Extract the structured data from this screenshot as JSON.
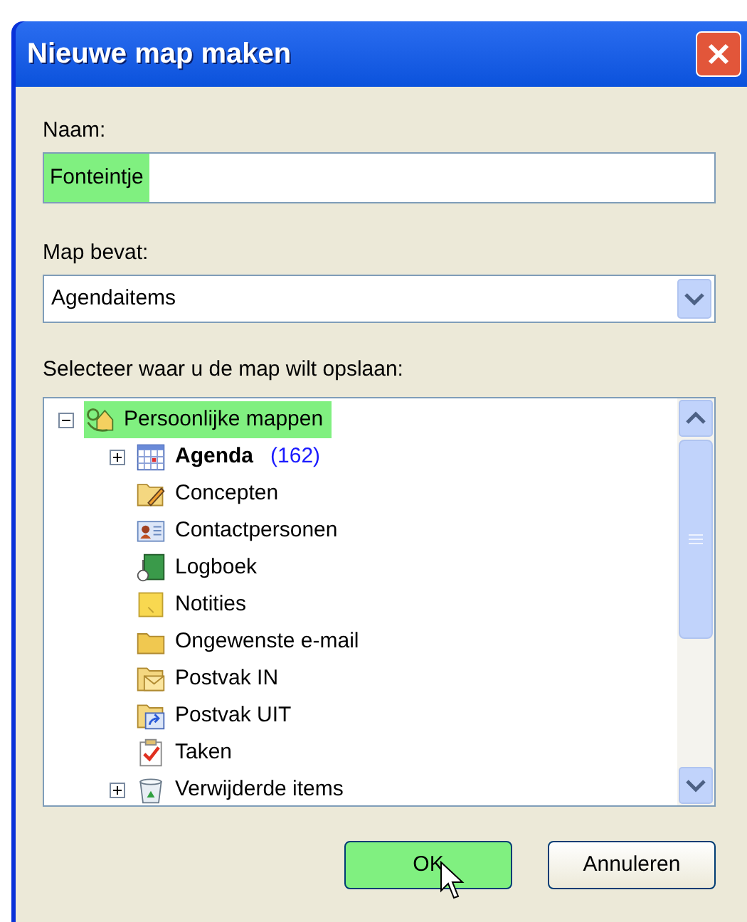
{
  "window": {
    "title": "Nieuwe map maken"
  },
  "name_field": {
    "label": "Naam:",
    "value": "Fonteintje",
    "highlighted": true
  },
  "contents_field": {
    "label": "Map bevat:",
    "value": "Agendaitems"
  },
  "tree": {
    "label": "Selecteer waar u de map wilt opslaan:",
    "items": [
      {
        "label": "Persoonlijke mappen",
        "kind": "personal",
        "expanded": true,
        "highlighted": true,
        "bold": false,
        "children": [
          {
            "label": "Agenda",
            "count": "(162)",
            "kind": "calendar",
            "expanded": false,
            "highlighted": false,
            "bold": true
          },
          {
            "label": "Concepten",
            "kind": "drafts",
            "highlighted": false,
            "bold": false
          },
          {
            "label": "Contactpersonen",
            "kind": "contacts",
            "highlighted": false,
            "bold": false
          },
          {
            "label": "Logboek",
            "kind": "journal",
            "highlighted": false,
            "bold": false
          },
          {
            "label": "Notities",
            "kind": "notes",
            "highlighted": false,
            "bold": false
          },
          {
            "label": "Ongewenste e-mail",
            "kind": "folder",
            "highlighted": false,
            "bold": false
          },
          {
            "label": "Postvak IN",
            "kind": "inbox",
            "highlighted": false,
            "bold": false
          },
          {
            "label": "Postvak UIT",
            "kind": "outbox",
            "highlighted": false,
            "bold": false
          },
          {
            "label": "Taken",
            "kind": "tasks",
            "highlighted": false,
            "bold": false
          },
          {
            "label": "Verwijderde items",
            "kind": "trash",
            "expanded": false,
            "highlighted": false,
            "bold": false
          }
        ]
      }
    ]
  },
  "buttons": [
    {
      "label": "OK",
      "highlighted": true
    },
    {
      "label": "Annuleren",
      "highlighted": false
    }
  ]
}
